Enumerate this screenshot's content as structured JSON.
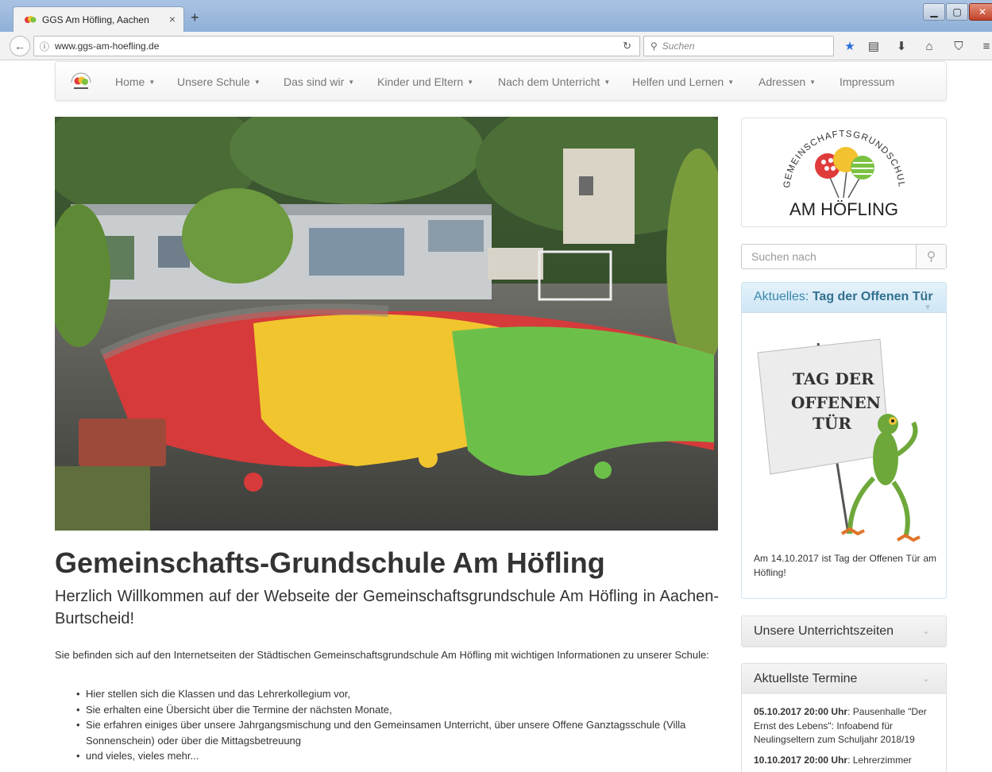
{
  "browser": {
    "tab_title": "GGS Am Höfling, Aachen",
    "tab_close": "×",
    "new_tab": "+",
    "url": "www.ggs-am-hoefling.de",
    "search_placeholder": "Suchen",
    "icons": [
      "back-arrow-icon",
      "info-icon",
      "reload-icon",
      "search-icon",
      "star-icon",
      "reading-list-icon",
      "download-icon",
      "home-icon",
      "pocket-icon",
      "menu-icon"
    ]
  },
  "nav": {
    "items": [
      {
        "label": "Home",
        "dropdown": true
      },
      {
        "label": "Unsere Schule",
        "dropdown": true
      },
      {
        "label": "Das sind wir",
        "dropdown": true
      },
      {
        "label": "Kinder und Eltern",
        "dropdown": true
      },
      {
        "label": "Nach dem Unterricht",
        "dropdown": true
      },
      {
        "label": "Helfen und Lernen",
        "dropdown": true
      },
      {
        "label": "Adressen",
        "dropdown": true
      },
      {
        "label": "Impressum",
        "dropdown": false
      }
    ]
  },
  "main": {
    "title": "Gemeinschafts-Grundschule Am Höfling",
    "welcome": "Herzlich Willkommen auf der Webseite der Gemeinschaftsgrundschule Am Höfling in Aachen-Burtscheid!",
    "intro": "Sie befinden sich auf den Internetseiten der Städtischen Gemeinschaftsgrundschule Am Höfling mit wichtigen Informationen zu unserer Schule:",
    "bullets": [
      "Hier stellen sich die Klassen und das Lehrerkollegium vor,",
      "Sie erhalten eine Übersicht über die Termine der nächsten Monate,",
      "Sie erfahren einiges über unsere Jahrgangsmischung und den Gemeinsamen Unterricht, über unsere Offene Ganztagsschule (Villa Sonnenschein) oder über die Mittagsbetreuung",
      "und vieles, vieles mehr..."
    ]
  },
  "sidebar": {
    "logo_arc_text": "GEMEINSCHAFTSGRUNDSCHULE",
    "logo_name": "AM HÖFLING",
    "search_placeholder": "Suchen nach",
    "news": {
      "prefix": "Aktuelles:",
      "title": "Tag der Offenen Tür",
      "sign_line1": "TAG DER",
      "sign_line2": "OFFENEN",
      "sign_line3": "TÜR",
      "text": "Am 14.10.2017 ist Tag der Offenen Tür am Höfling!"
    },
    "panel_times": "Unsere Unterrichtszeiten",
    "panel_termine": "Aktuellste Termine",
    "termine": [
      {
        "date": "05.10.2017 20:00 Uhr",
        "text": ": Pausenhalle \"Der Ernst des Lebens\": Infoabend für Neulingseltern zum Schuljahr 2018/19"
      },
      {
        "date": "10.10.2017 20:00 Uhr",
        "text": ": Lehrerzimmer"
      }
    ]
  }
}
